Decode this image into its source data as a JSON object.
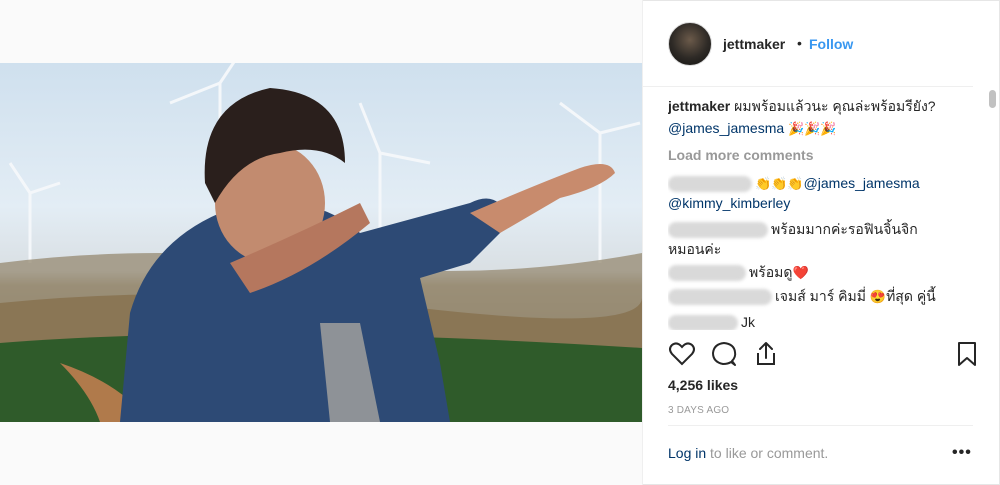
{
  "post": {
    "username": "jettmaker",
    "separator": "•",
    "follow_label": "Follow",
    "caption_user": "jettmaker",
    "caption_text": "ผมพร้อมแล้วนะ คุณล่ะพร้อมรียัง?",
    "caption_mention": "@james_jamesma",
    "caption_emoji": "🎉🎉🎉",
    "load_more": "Load more comments",
    "comments": [
      {
        "emoji": "👏👏👏",
        "mention": "@james_jamesma",
        "mention2": "@kimmy_kimberley",
        "text": ""
      },
      {
        "text": "พร้อมมากค่ะรอฟินจิ้นจิก",
        "text2": "หมอนค่ะ"
      },
      {
        "text": "พร้อมดู",
        "emoji": "❤️"
      },
      {
        "text": "เจมส์ มาร์ คิมมี่",
        "emoji": "😍",
        "text2": "ที่สุด คู่นี้"
      },
      {
        "text": "Jk"
      }
    ],
    "likes": "4,256 likes",
    "time": "3 DAYS AGO",
    "login_link": "Log in",
    "login_text": " to like or comment.",
    "more_label": "•••"
  },
  "icons": {
    "like": "heart-icon",
    "comment": "comment-icon",
    "share": "share-icon",
    "save": "bookmark-icon"
  }
}
